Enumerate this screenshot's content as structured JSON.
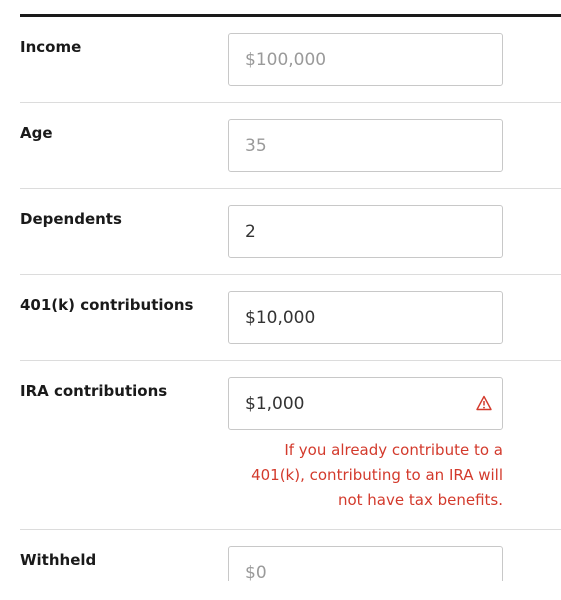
{
  "form": {
    "fields": [
      {
        "label": "Income",
        "value": "",
        "placeholder": "$100,000"
      },
      {
        "label": "Age",
        "value": "",
        "placeholder": "35"
      },
      {
        "label": "Dependents",
        "value": "2",
        "placeholder": ""
      },
      {
        "label": "401(k) contributions",
        "value": "$10,000",
        "placeholder": ""
      },
      {
        "label": "IRA contributions",
        "value": "$1,000",
        "placeholder": "",
        "error": "If you already contribute to a 401(k), contributing to an IRA will not have tax benefits.",
        "icon": "warning-icon"
      },
      {
        "label": "Withheld",
        "value": "",
        "placeholder": "$0"
      }
    ]
  },
  "colors": {
    "error": "#d33a2c",
    "border": "#c8c8c8",
    "divider": "#dcdcdc",
    "top_rule": "#1a1a1a"
  }
}
